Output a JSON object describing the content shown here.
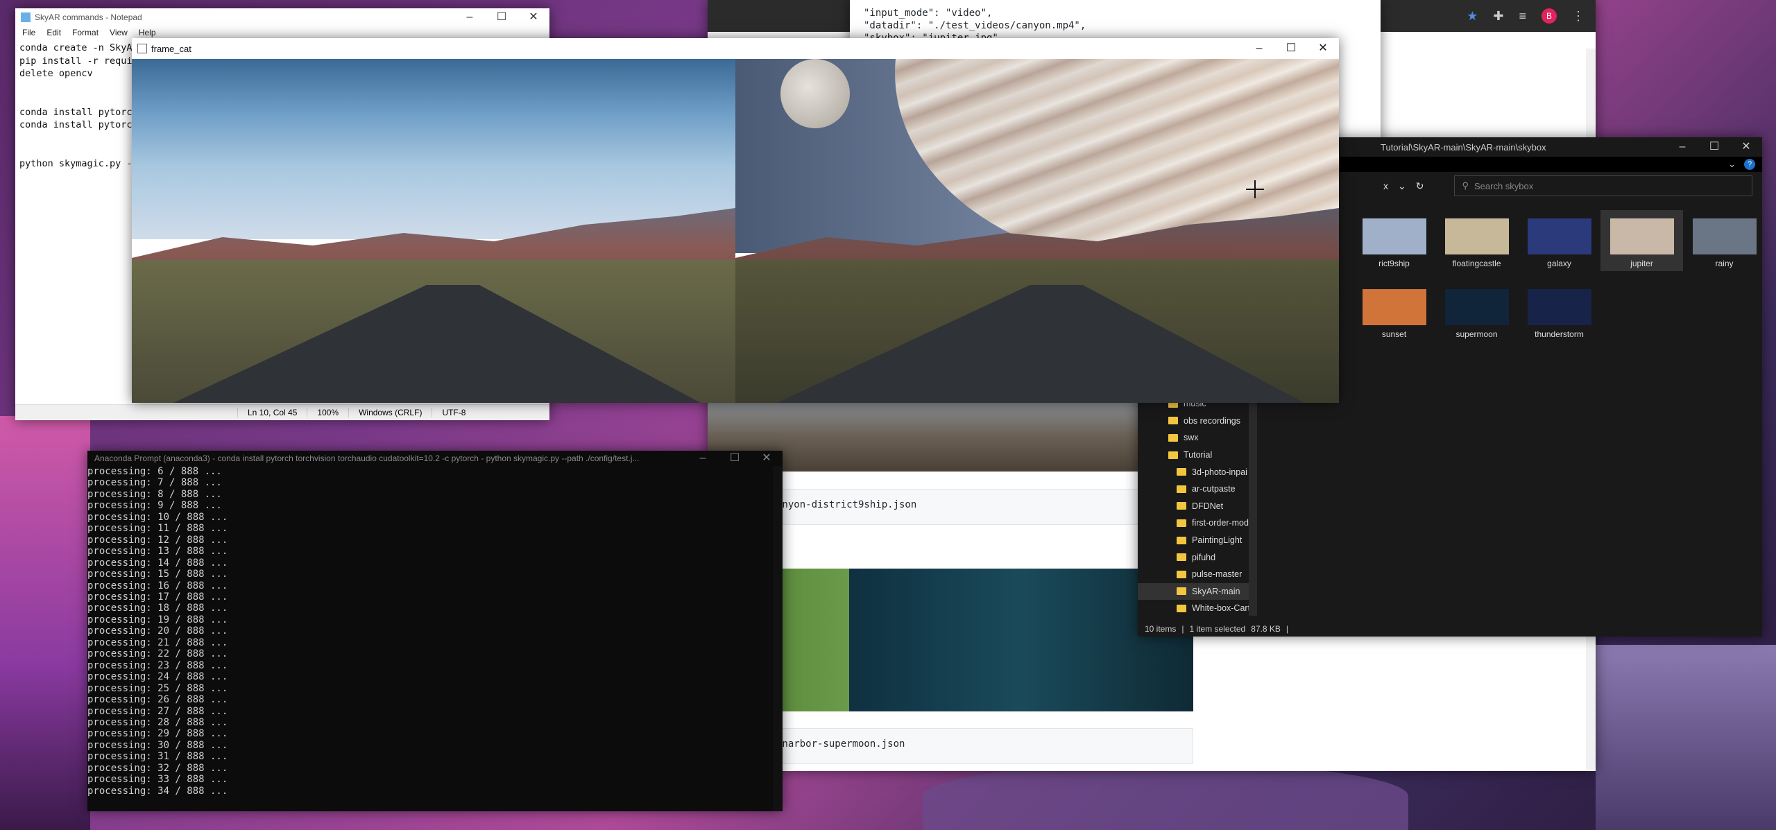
{
  "browser": {
    "avatar": "B",
    "code1": "anyon-district9ship.json",
    "code2": "nnarbor-supermoon.json"
  },
  "jsondoc": {
    "lines": [
      "\"input_mode\": \"video\",",
      "\"datadir\": \"./test_videos/canyon.mp4\",",
      "\"skybox\": \"jupiter.jpg\","
    ]
  },
  "notepad": {
    "title": "SkyAR commands - Notepad",
    "menu": [
      "File",
      "Edit",
      "Format",
      "View",
      "Help"
    ],
    "text": "conda create -n SkyAR\npip install -r requi\ndelete opencv\n\n\nconda install pytorc\nconda install pytorc\n\n\npython skymagic.py -",
    "status": {
      "pos": "Ln 10, Col 45",
      "zoom": "100%",
      "eol": "Windows (CRLF)",
      "enc": "UTF-8"
    }
  },
  "framecat": {
    "title": "frame_cat"
  },
  "explorer": {
    "path": "Tutorial\\SkyAR-main\\SkyAR-main\\skybox",
    "view": "x",
    "search_placeholder": "Search skybox",
    "thumbs": [
      {
        "label": "rict9ship",
        "color": "#9fb0c8"
      },
      {
        "label": "floatingcastle",
        "color": "#c8b89a"
      },
      {
        "label": "galaxy",
        "color": "#2a3a7a"
      },
      {
        "label": "jupiter",
        "color": "#c9b8a8"
      },
      {
        "label": "rainy",
        "color": "#6a7585"
      },
      {
        "label": "sunset",
        "color": "#d0743a"
      },
      {
        "label": "supermoon",
        "color": "#10243a"
      },
      {
        "label": "thunderstorm",
        "color": "#18234a"
      }
    ],
    "tree": [
      "music",
      "obs recordings",
      "swx",
      "Tutorial",
      "3d-photo-inpai",
      "ar-cutpaste",
      "DFDNet",
      "first-order-mod",
      "PaintingLight",
      "pifuhd",
      "pulse-master",
      "SkyAR-main",
      "White-box-Cart"
    ],
    "status": {
      "items": "10 items",
      "selected": "1 item selected",
      "size": "87.8 KB"
    }
  },
  "prompt": {
    "title": "Anaconda Prompt (anaconda3) - conda  install pytorch torchvision torchaudio cudatoolkit=10.2 -c pytorch - python  skymagic.py --path ./config/test.j...",
    "lines": [
      "processing: 6 / 888 ...",
      "processing: 7 / 888 ...",
      "processing: 8 / 888 ...",
      "processing: 9 / 888 ...",
      "processing: 10 / 888 ...",
      "processing: 11 / 888 ...",
      "processing: 12 / 888 ...",
      "processing: 13 / 888 ...",
      "processing: 14 / 888 ...",
      "processing: 15 / 888 ...",
      "processing: 16 / 888 ...",
      "processing: 17 / 888 ...",
      "processing: 18 / 888 ...",
      "processing: 19 / 888 ...",
      "processing: 20 / 888 ...",
      "processing: 21 / 888 ...",
      "processing: 22 / 888 ...",
      "processing: 23 / 888 ...",
      "processing: 24 / 888 ...",
      "processing: 25 / 888 ...",
      "processing: 26 / 888 ...",
      "processing: 27 / 888 ...",
      "processing: 28 / 888 ...",
      "processing: 29 / 888 ...",
      "processing: 30 / 888 ...",
      "processing: 31 / 888 ...",
      "processing: 32 / 888 ...",
      "processing: 33 / 888 ...",
      "processing: 34 / 888 ..."
    ]
  }
}
